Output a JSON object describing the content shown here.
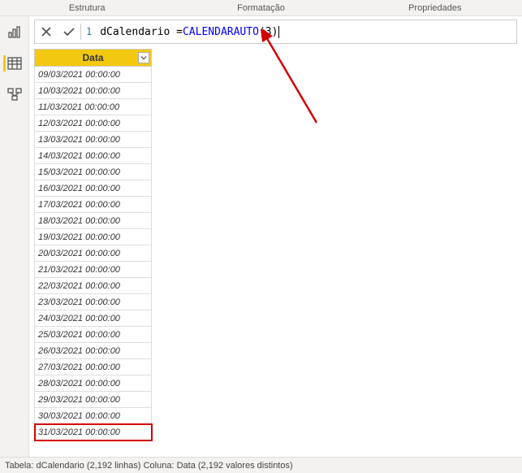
{
  "tabs": {
    "structure": "Estrutura",
    "formatting": "Formatação",
    "properties": "Propriedades"
  },
  "formula": {
    "line_number": "1",
    "text_prefix": "dCalendario = ",
    "func_name": "CALENDARAUTO",
    "open_paren": "(",
    "arg": "3",
    "close_paren": ")"
  },
  "column": {
    "header": "Data"
  },
  "rows": [
    "09/03/2021 00:00:00",
    "10/03/2021 00:00:00",
    "11/03/2021 00:00:00",
    "12/03/2021 00:00:00",
    "13/03/2021 00:00:00",
    "14/03/2021 00:00:00",
    "15/03/2021 00:00:00",
    "16/03/2021 00:00:00",
    "17/03/2021 00:00:00",
    "18/03/2021 00:00:00",
    "19/03/2021 00:00:00",
    "20/03/2021 00:00:00",
    "21/03/2021 00:00:00",
    "22/03/2021 00:00:00",
    "23/03/2021 00:00:00",
    "24/03/2021 00:00:00",
    "25/03/2021 00:00:00",
    "26/03/2021 00:00:00",
    "27/03/2021 00:00:00",
    "28/03/2021 00:00:00",
    "29/03/2021 00:00:00",
    "30/03/2021 00:00:00",
    "31/03/2021 00:00:00"
  ],
  "highlight_index": 22,
  "status": "Tabela: dCalendario (2,192 linhas) Coluna: Data (2,192 valores distintos)",
  "icons": {
    "report": "report-view-icon",
    "data": "data-view-icon",
    "model": "model-view-icon",
    "cancel": "x-icon",
    "commit": "check-icon",
    "dropdown": "chevron-down-icon"
  }
}
